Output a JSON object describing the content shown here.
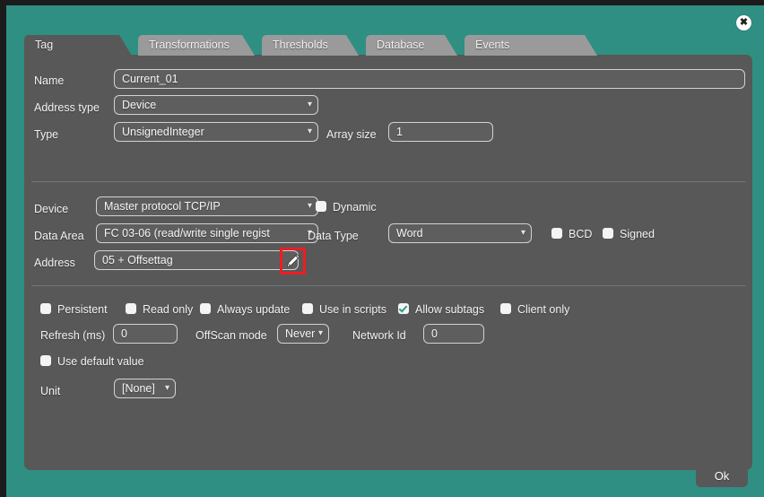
{
  "colors": {
    "dialog_bg": "#2f8f82",
    "panel_bg": "#585858",
    "tab_inactive": "#9a9a9a",
    "accent_check": "#2f9e8c",
    "highlight_red": "#ef1c24",
    "field_bg": "#5e5e5e"
  },
  "window": {
    "close_label": "✖"
  },
  "tabs": [
    {
      "label": "Tag",
      "active": true
    },
    {
      "label": "Transformations",
      "active": false
    },
    {
      "label": "Thresholds",
      "active": false
    },
    {
      "label": "Database",
      "active": false
    },
    {
      "label": "Events",
      "active": false
    }
  ],
  "form": {
    "name": {
      "label": "Name",
      "value": "Current_01"
    },
    "address_type": {
      "label": "Address type",
      "value": "Device"
    },
    "type": {
      "label": "Type",
      "value": "UnsignedInteger"
    },
    "array_size": {
      "label": "Array size",
      "value": "1"
    },
    "device": {
      "label": "Device",
      "value": "Master protocol TCP/IP"
    },
    "dynamic": {
      "label": "Dynamic",
      "checked": false
    },
    "data_area": {
      "label": "Data Area",
      "value": "FC 03-06 (read/write single regist"
    },
    "data_type": {
      "label": "Data Type",
      "value": "Word"
    },
    "bcd": {
      "label": "BCD",
      "checked": false
    },
    "signed": {
      "label": "Signed",
      "checked": false
    },
    "address": {
      "label": "Address",
      "value": "05  + Offsettag",
      "edit_icon": "pencil-icon"
    }
  },
  "options": {
    "checkboxes": [
      {
        "label": "Persistent",
        "checked": false
      },
      {
        "label": "Read only",
        "checked": false
      },
      {
        "label": "Always update",
        "checked": false
      },
      {
        "label": "Use in scripts",
        "checked": false
      },
      {
        "label": "Allow subtags",
        "checked": true
      },
      {
        "label": "Client only",
        "checked": false
      }
    ],
    "refresh": {
      "label": "Refresh (ms)",
      "value": "0"
    },
    "offscan_mode": {
      "label": "OffScan mode",
      "value": "Never"
    },
    "network_id": {
      "label": "Network Id",
      "value": "0"
    },
    "use_default_value": {
      "label": "Use default value",
      "checked": false
    },
    "unit": {
      "label": "Unit",
      "value": "[None]"
    }
  },
  "footer": {
    "ok_label": "Ok"
  }
}
